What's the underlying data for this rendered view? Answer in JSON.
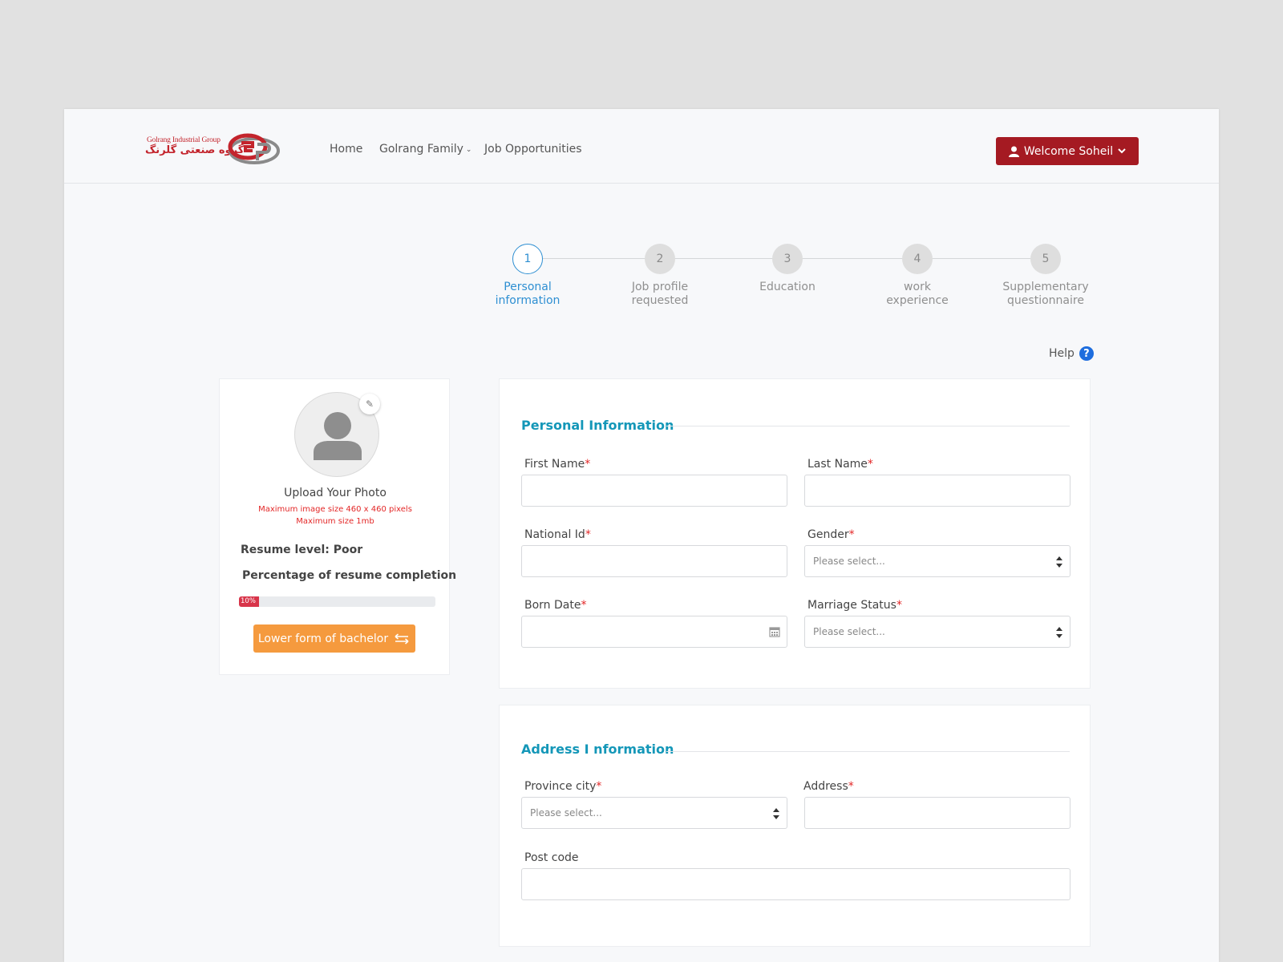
{
  "nav": {
    "logo_en": "Golrang Industrial Group",
    "logo_fa": "گروه صنعتی گلرنگ",
    "home": "Home",
    "family": "Golrang Family",
    "jobs": "Job Opportunities",
    "welcome": "Welcome Soheil"
  },
  "stepper": {
    "steps": [
      {
        "num": "1",
        "label": "Personal\ninformation",
        "active": true
      },
      {
        "num": "2",
        "label": "Job profile\nrequested",
        "active": false
      },
      {
        "num": "3",
        "label": "Education",
        "active": false
      },
      {
        "num": "4",
        "label": "work\nexperience",
        "active": false
      },
      {
        "num": "5",
        "label": "Supplementary\nquestionnaire",
        "active": false
      }
    ]
  },
  "help": {
    "label": "Help",
    "icon": "?"
  },
  "profile": {
    "upload_title": "Upload Your Photo",
    "hint_size": "Maximum image size 460 x 460 pixels",
    "hint_mb": "Maximum size 1mb",
    "resume_level": "Resume level: Poor",
    "completion_title": "Percentage of resume completion",
    "completion_label": "10%",
    "completion_value": 10,
    "lower_form_button": "Lower form of bachelor"
  },
  "personal": {
    "title": "Personal Information",
    "first_name": "First Name",
    "last_name": "Last Name",
    "national_id": "National Id",
    "gender": "Gender",
    "gender_placeholder": "Please select...",
    "born_date": "Born Date",
    "marriage": "Marriage Status",
    "marriage_placeholder": "Please select...",
    "required_mark": "*"
  },
  "address": {
    "title": "Address I nformation",
    "province": "Province city",
    "province_placeholder": "Please select...",
    "address": "Address",
    "post_code": "Post code",
    "required_mark": "*"
  },
  "colors": {
    "brand_red": "#a51a22",
    "accent_blue": "#2e8fd2",
    "section_teal": "#1497b8",
    "orange": "#f59a3e",
    "progress_red": "#d8354a"
  }
}
